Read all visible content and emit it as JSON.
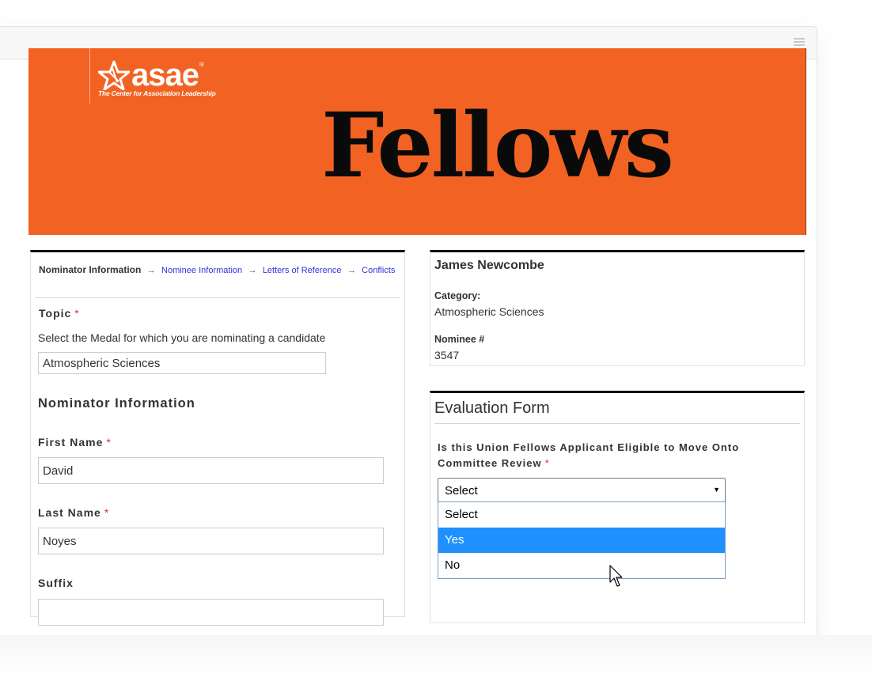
{
  "window": {
    "menu_icon": "hamburger-menu-icon"
  },
  "banner": {
    "logo_word": "asae",
    "logo_registered": "®",
    "logo_tagline": "The Center for Association Leadership",
    "logo_icon": "star-icon",
    "title": "Fellows",
    "background_color": "#f26323"
  },
  "breadcrumb": {
    "current": "Nominator Information",
    "separator": "→",
    "steps": [
      "Nominee Information",
      "Letters of Reference",
      "Conflicts"
    ]
  },
  "form": {
    "topic": {
      "label": "Topic",
      "required_mark": "*",
      "help": "Select the Medal for which you are nominating a candidate",
      "value": "Atmospheric Sciences"
    },
    "section_title": "Nominator Information",
    "first_name": {
      "label": "First Name",
      "required_mark": "*",
      "value": "David"
    },
    "last_name": {
      "label": "Last Name",
      "required_mark": "*",
      "value": "Noyes"
    },
    "suffix": {
      "label": "Suffix",
      "value": ""
    }
  },
  "nominee": {
    "name": "James Newcombe",
    "category_label": "Category:",
    "category_value": "Atmospheric Sciences",
    "number_label": "Nominee #",
    "number_value": "3547"
  },
  "evaluation": {
    "title": "Evaluation Form",
    "question": "Is this Union Fellows Applicant Eligible to Move Onto Committee Review",
    "required_mark": "*",
    "selected": "Select",
    "options": [
      "Select",
      "Yes",
      "No"
    ],
    "highlighted_option": "Yes",
    "highlight_color": "#1e90ff"
  }
}
